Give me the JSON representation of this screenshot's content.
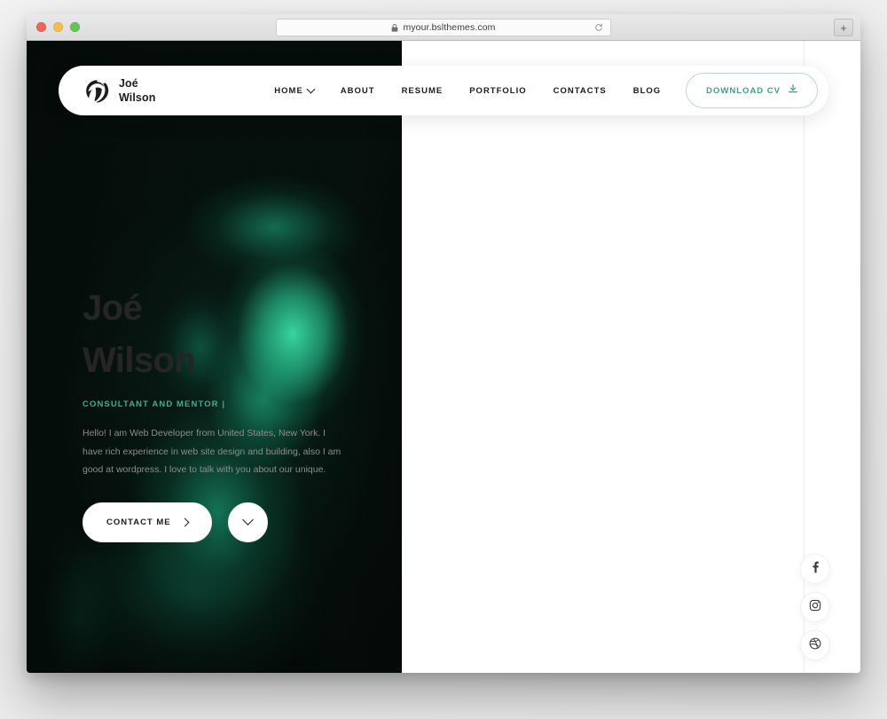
{
  "browser": {
    "url": "myour.bslthemes.com",
    "lock_icon": "lock-icon",
    "reload_icon": "reload-icon",
    "new_tab_label": "+",
    "traffic_lights": [
      "close",
      "minimize",
      "zoom"
    ]
  },
  "site": {
    "brand": {
      "mark_icon": "brand-logo-icon",
      "name": "Joé\nWilson"
    },
    "nav": [
      {
        "label": "HOME",
        "has_dropdown": true
      },
      {
        "label": "ABOUT",
        "has_dropdown": false
      },
      {
        "label": "RESUME",
        "has_dropdown": false
      },
      {
        "label": "PORTFOLIO",
        "has_dropdown": false
      },
      {
        "label": "CONTACTS",
        "has_dropdown": false
      },
      {
        "label": "BLOG",
        "has_dropdown": false
      }
    ],
    "cv_button": {
      "label": "DOWNLOAD CV",
      "icon": "download-icon"
    },
    "hero": {
      "first_name": "Joé",
      "last_name": "Wilson",
      "role": "CONSULTANT AND MENTOR |",
      "description": "Hello! I am Web Developer from United States, New York. I have rich experience in web site design and building, also I am good at wordpress. I love to talk with you about our unique.",
      "contact_button": "CONTACT ME",
      "contact_icon": "arrow-right-icon",
      "scroll_icon": "chevron-down-icon"
    },
    "social": [
      {
        "name": "facebook",
        "icon": "facebook-icon"
      },
      {
        "name": "instagram",
        "icon": "instagram-icon"
      },
      {
        "name": "dribbble",
        "icon": "dribbble-icon"
      }
    ],
    "colors": {
      "accent": "#45a98c",
      "accent_border": "#b7dbcd",
      "heading": "#252525",
      "body_text": "#8d8d8d",
      "panel_dark": "#060a08",
      "portrait_green": "#2bbd8c"
    }
  }
}
